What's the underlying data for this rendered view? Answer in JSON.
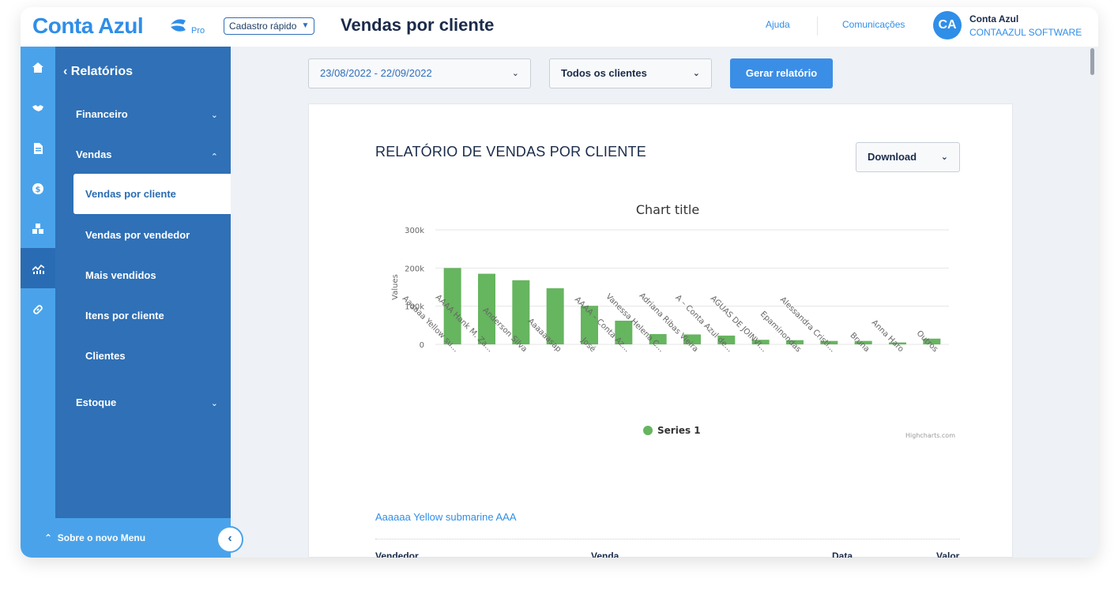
{
  "header": {
    "brand": "Conta Azul",
    "plan": "Pro",
    "quick_register": "Cadastro rápido",
    "page_title": "Vendas por cliente",
    "help": "Ajuda",
    "communications": "Comunicações",
    "avatar_initials": "CA",
    "user_name": "Conta Azul",
    "user_company": "CONTAAZUL SOFTWARE"
  },
  "rail": {
    "icons": [
      "home-icon",
      "handshake-icon",
      "document-icon",
      "dollar-icon",
      "boxes-icon",
      "reports-chart-icon",
      "link-icon"
    ],
    "active_index": 5
  },
  "sidebar": {
    "back_label": "Relatórios",
    "financeiro": "Financeiro",
    "vendas": "Vendas",
    "vendas_por_cliente": "Vendas por cliente",
    "vendas_por_vendedor": "Vendas por vendedor",
    "mais_vendidos": "Mais vendidos",
    "itens_por_cliente": "Itens por cliente",
    "clientes": "Clientes",
    "estoque": "Estoque",
    "bottom_menu": "Sobre o novo Menu"
  },
  "filters": {
    "date_range": "23/08/2022 - 22/09/2022",
    "clients": "Todos os clientes",
    "generate": "Gerar relatório"
  },
  "report": {
    "title": "RELATÓRIO DE VENDAS POR CLIENTE",
    "download": "Download",
    "first_client": "Aaaaaa Yellow submarine AAA",
    "table_headers": {
      "vendedor": "Vendedor",
      "venda": "Venda",
      "data": "Data",
      "valor": "Valor"
    }
  },
  "colors": {
    "primary": "#2f8ee8",
    "sidebar": "#2f70b6",
    "rail": "#4aa3ea",
    "bar": "#66b55f"
  },
  "chart_data": {
    "type": "bar",
    "title": "Chart title",
    "ylabel": "Values",
    "xlabel": "",
    "ylim": [
      0,
      300000
    ],
    "yticks": [
      "0",
      "100k",
      "200k",
      "300k"
    ],
    "categories": [
      "Aaaaaa Yellow su...",
      "AAAA Hank M. Za...",
      "Anderson Silva",
      "Aaaaaasap",
      "José",
      "AAAA – Conta Az...",
      "Vanessa Helena C...",
      "Adriana Ribas Vieira",
      "A – Conta Azul de...",
      "AGUAS DE JOINVI...",
      "Epaminondas",
      "Alessandra Cristi...",
      "Bruna",
      "Anna Haro",
      "Outros"
    ],
    "series": [
      {
        "name": "Series 1",
        "values": [
          200000,
          185000,
          168000,
          147000,
          101000,
          62000,
          27000,
          26000,
          23000,
          12000,
          11000,
          9000,
          9000,
          5000,
          15000
        ]
      }
    ],
    "legend": "bottom-center",
    "credits": "Highcharts.com",
    "grid": true
  }
}
